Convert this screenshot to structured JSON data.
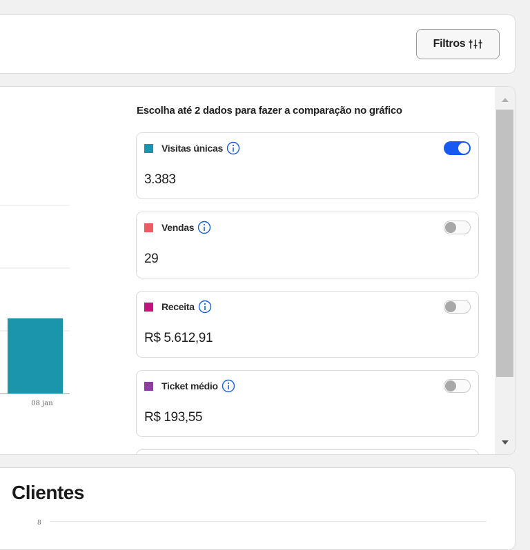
{
  "toolbar": {
    "filters_label": "Filtros"
  },
  "panel": {
    "instruction": "Escolha até 2 dados para fazer a comparação no gráfico",
    "metrics": [
      {
        "label": "Visitas únicas",
        "value": "3.383",
        "color": "#1a95ab",
        "enabled": true
      },
      {
        "label": "Vendas",
        "value": "29",
        "color": "#ec5c64",
        "enabled": false
      },
      {
        "label": "Receita",
        "value": "R$ 5.612,91",
        "color": "#c4137c",
        "enabled": false
      },
      {
        "label": "Ticket médio",
        "value": "R$ 193,55",
        "color": "#8e3da1",
        "enabled": false
      }
    ]
  },
  "chart_data": {
    "type": "bar",
    "categories": [
      "08 jan"
    ],
    "values": [
      1.2
    ],
    "ylim": [
      0,
      4
    ],
    "grid": true,
    "color": "#1a95ab"
  },
  "clients": {
    "title": "Clientes",
    "y_tick": "8"
  }
}
